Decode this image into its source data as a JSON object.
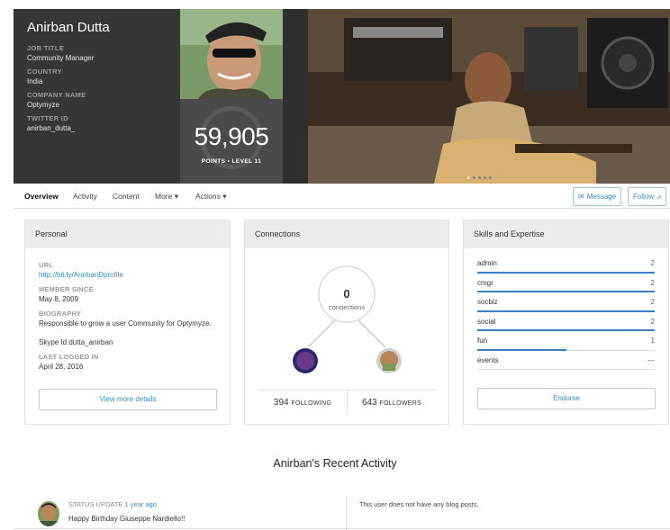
{
  "profile": {
    "name": "Anirban Dutta",
    "fields": [
      {
        "label": "JOB TITLE",
        "value": "Community Manager"
      },
      {
        "label": "COUNTRY",
        "value": "India"
      },
      {
        "label": "COMPANY NAME",
        "value": "Optymyze"
      },
      {
        "label": "TWITTER ID",
        "value": "anirban_dutta_"
      }
    ],
    "points": "59,905",
    "points_sub": "POINTS • LEVEL 11"
  },
  "nav": {
    "items": [
      "Overview",
      "Activity",
      "Content",
      "More ▾",
      "Actions ▾"
    ],
    "message_label": "Message",
    "follow_label": "Follow"
  },
  "personal": {
    "title": "Personal",
    "url_label": "URL",
    "url": "http://bit.ly/AnirbanDprofile",
    "member_label": "MEMBER SINCE",
    "member_since": "May 8, 2009",
    "bio_label": "BIOGRAPHY",
    "bio": "Responsible to grow a user Community for Optymyze.",
    "skype": "Skype Id dutta_anirban",
    "last_label": "LAST LOGGED IN",
    "last_logged": "April 28, 2016",
    "view_more": "View more details"
  },
  "connections": {
    "title": "Connections",
    "count": "0",
    "label": "connections",
    "following_num": "394",
    "following_label": "FOLLOWING",
    "followers_num": "643",
    "followers_label": "FOLLOWERS"
  },
  "skills": {
    "title": "Skills and Expertise",
    "items": [
      {
        "name": "admin",
        "count": "2",
        "level": 1.0
      },
      {
        "name": "cmgr",
        "count": "2",
        "level": 1.0
      },
      {
        "name": "socbiz",
        "count": "2",
        "level": 1.0
      },
      {
        "name": "social",
        "count": "2",
        "level": 1.0
      },
      {
        "name": "fun",
        "count": "1",
        "level": 0.5
      },
      {
        "name": "events",
        "count": "—",
        "level": 0
      }
    ],
    "endorse": "Endorse"
  },
  "recent": {
    "title": "Anirban's Recent Activity",
    "type": "STATUS UPDATE",
    "time": "1 year ago",
    "text": "Happy Birthday Giuseppe Nardiello!!",
    "no_blog": "This user does not have any blog posts."
  },
  "colors": {
    "accent": "#3a8bc8",
    "skill_bar": "#3a7fc4",
    "header_bg": "#363636"
  }
}
